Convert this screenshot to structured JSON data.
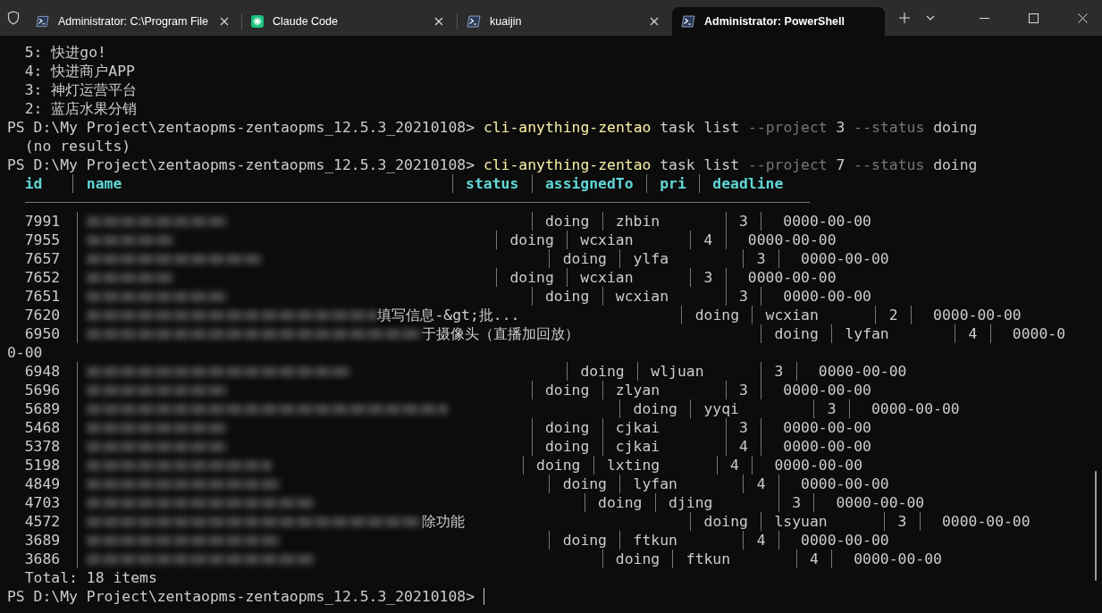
{
  "tabs": [
    {
      "title": "Administrator: C:\\Program File",
      "kind": "shell",
      "selected": false
    },
    {
      "title": "Claude Code",
      "kind": "agent",
      "selected": false
    },
    {
      "title": "kuaijin",
      "kind": "shell",
      "selected": false
    },
    {
      "title": "Administrator: PowerShell",
      "kind": "shell",
      "selected": true
    }
  ],
  "terminal": {
    "lines": [
      {
        "kind": "output",
        "text": "5: 快进go!"
      },
      {
        "kind": "output",
        "text": "4: 快进商户APP"
      },
      {
        "kind": "output",
        "text": "3: 神灯运营平台"
      },
      {
        "kind": "output",
        "text": "2: 蓝店水果分销"
      },
      {
        "kind": "prompt",
        "prompt": "PS D:\\My Project\\zentaopms-zentaopms_12.5.3_20210108>",
        "segments": [
          {
            "kind": "command",
            "text": "cli-anything-zentao"
          },
          {
            "kind": "plain",
            "text": "task list"
          },
          {
            "kind": "flag",
            "text": "--project"
          },
          {
            "kind": "plain",
            "text": "3"
          },
          {
            "kind": "flag",
            "text": "--status"
          },
          {
            "kind": "plain",
            "text": "doing"
          }
        ]
      },
      {
        "kind": "output",
        "text": "(no results)"
      },
      {
        "kind": "prompt",
        "prompt": "PS D:\\My Project\\zentaopms-zentaopms_12.5.3_20210108>",
        "segments": [
          {
            "kind": "command",
            "text": "cli-anything-zentao"
          },
          {
            "kind": "plain",
            "text": "task list"
          },
          {
            "kind": "flag",
            "text": "--project"
          },
          {
            "kind": "plain",
            "text": "7"
          },
          {
            "kind": "flag",
            "text": "--status"
          },
          {
            "kind": "plain",
            "text": "doing"
          }
        ]
      },
      {
        "kind": "header",
        "columns": [
          "id",
          "name",
          "status",
          "assignedTo",
          "pri",
          "deadline"
        ]
      },
      {
        "kind": "rule"
      },
      {
        "kind": "row",
        "id": "7991",
        "status": "doing",
        "assigned_to": "zhbin",
        "pri": "3",
        "deadline": "0000-00-00"
      },
      {
        "kind": "row",
        "id": "7955",
        "status": "doing",
        "assigned_to": "wcxian",
        "pri": "4",
        "deadline": "0000-00-00"
      },
      {
        "kind": "row",
        "id": "7657",
        "status": "doing",
        "assigned_to": "ylfa",
        "pri": "3",
        "deadline": "0000-00-00"
      },
      {
        "kind": "row",
        "id": "7652",
        "status": "doing",
        "assigned_to": "wcxian",
        "pri": "3",
        "deadline": "0000-00-00"
      },
      {
        "kind": "row",
        "id": "7651",
        "status": "doing",
        "assigned_to": "wcxian",
        "pri": "3",
        "deadline": "0000-00-00"
      },
      {
        "kind": "row",
        "id": "7620",
        "name_tail": "填写信息-&gt;批...",
        "status": "doing",
        "assigned_to": "wcxian",
        "pri": "2",
        "deadline": "0000-00-00"
      },
      {
        "kind": "row",
        "id": "6950",
        "name_tail": "于摄像头（直播加回放）",
        "status": "doing",
        "assigned_to": "lyfan",
        "pri": "4",
        "deadline": "0000-0"
      },
      {
        "kind": "wrap",
        "text": "0-00"
      },
      {
        "kind": "row",
        "id": "6948",
        "status": "doing",
        "assigned_to": "wljuan",
        "pri": "3",
        "deadline": "0000-00-00"
      },
      {
        "kind": "row",
        "id": "5696",
        "status": "doing",
        "assigned_to": "zlyan",
        "pri": "3",
        "deadline": "0000-00-00"
      },
      {
        "kind": "row",
        "id": "5689",
        "status": "doing",
        "assigned_to": "yyqi",
        "pri": "3",
        "deadline": "0000-00-00"
      },
      {
        "kind": "row",
        "id": "5468",
        "status": "doing",
        "assigned_to": "cjkai",
        "pri": "3",
        "deadline": "0000-00-00"
      },
      {
        "kind": "row",
        "id": "5378",
        "status": "doing",
        "assigned_to": "cjkai",
        "pri": "4",
        "deadline": "0000-00-00"
      },
      {
        "kind": "row",
        "id": "5198",
        "status": "doing",
        "assigned_to": "lxting",
        "pri": "4",
        "deadline": "0000-00-00"
      },
      {
        "kind": "row",
        "id": "4849",
        "status": "doing",
        "assigned_to": "lyfan",
        "pri": "4",
        "deadline": "0000-00-00"
      },
      {
        "kind": "row",
        "id": "4703",
        "status": "doing",
        "assigned_to": "djing",
        "pri": "3",
        "deadline": "0000-00-00"
      },
      {
        "kind": "row",
        "id": "4572",
        "name_tail": "除功能",
        "status": "doing",
        "assigned_to": "lsyuan",
        "pri": "3",
        "deadline": "0000-00-00"
      },
      {
        "kind": "row",
        "id": "3689",
        "status": "doing",
        "assigned_to": "ftkun",
        "pri": "4",
        "deadline": "0000-00-00"
      },
      {
        "kind": "row",
        "id": "3686",
        "status": "doing",
        "assigned_to": "ftkun",
        "pri": "4",
        "deadline": "0000-00-00"
      },
      {
        "kind": "output",
        "text": "Total: 18 items"
      },
      {
        "kind": "prompt",
        "prompt": "PS D:\\My Project\\zentaopms-zentaopms_12.5.3_20210108>",
        "cursor": true
      }
    ]
  }
}
